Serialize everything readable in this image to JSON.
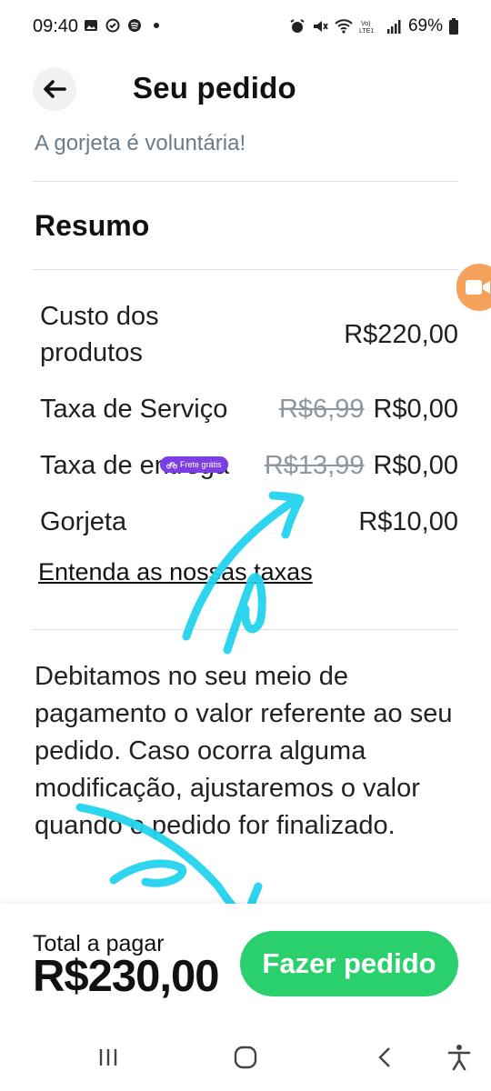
{
  "status_bar": {
    "time": "09:40",
    "battery": "69%",
    "left_icons": [
      "gallery-icon",
      "check-circle-icon",
      "spotify-icon",
      "dot-icon"
    ],
    "right_icons": [
      "alarm-icon",
      "mute-icon",
      "wifi-icon",
      "volte-icon",
      "signal-icon",
      "battery-icon"
    ]
  },
  "header": {
    "back_icon": "arrow-left-icon",
    "title": "Seu pedido"
  },
  "tip_note": "A gorjeta é voluntária!",
  "summary": {
    "title": "Resumo",
    "rows": [
      {
        "label_line1": "Custo dos",
        "label_line2": "produtos",
        "value": "R$220,00"
      },
      {
        "label": "Taxa de Serviço",
        "old_value": "R$6,99",
        "value": "R$0,00"
      },
      {
        "label": "Taxa de entrega",
        "badge": "Frete grátis",
        "badge_icon": "bike-icon",
        "old_value": "R$13,99",
        "value": "R$0,00"
      },
      {
        "label": "Gorjeta",
        "value": "R$10,00"
      }
    ],
    "link": "Entenda as nossas taxas"
  },
  "info_text": "Debitamos no seu meio de pagamento o valor referente ao seu pedido. Caso ocorra alguma modificação, ajustaremos o valor quando o pedido for finalizado.",
  "footer": {
    "total_label": "Total a pagar",
    "total_value": "R$230,00",
    "order_button": "Fazer pedido"
  },
  "nav_bar": {
    "icons": [
      "recent-apps-icon",
      "home-icon",
      "back-nav-icon",
      "accessibility-icon"
    ]
  },
  "colors": {
    "accent_green": "#2ad06c",
    "badge_purple": "#7b3fe4",
    "annotation_cyan": "#22d3ee",
    "muted_text": "#6f7b86"
  }
}
